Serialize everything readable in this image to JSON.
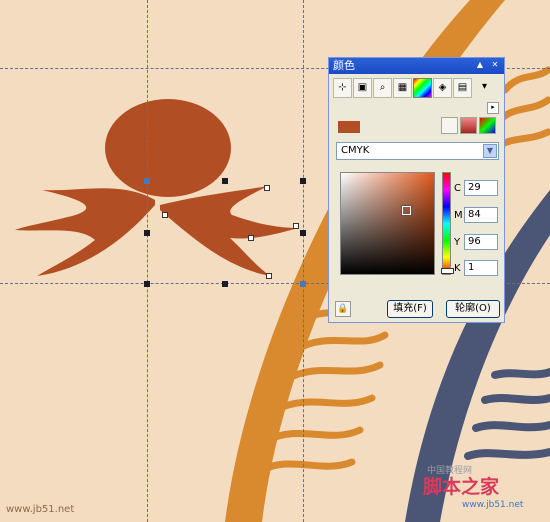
{
  "panel": {
    "title": "颜色",
    "model_select": "CMYK",
    "cmyk": [
      {
        "label": "C",
        "value": "29"
      },
      {
        "label": "M",
        "value": "84"
      },
      {
        "label": "Y",
        "value": "96"
      },
      {
        "label": "K",
        "value": "1"
      }
    ],
    "fill_button": "填充(F)",
    "outline_button": "轮廓(O)",
    "swatch_color": "#b24e23"
  },
  "canvas": {
    "shape_color": "#b24e23",
    "rib_color": "#d98a2e",
    "blue_rib_color": "#4b5575",
    "background": "#f4dcc0"
  },
  "watermark": {
    "left": "www.jb51.net",
    "right_cn": "脚本之家",
    "right_url": "www.jb51.net",
    "faded": "中国教程网"
  }
}
